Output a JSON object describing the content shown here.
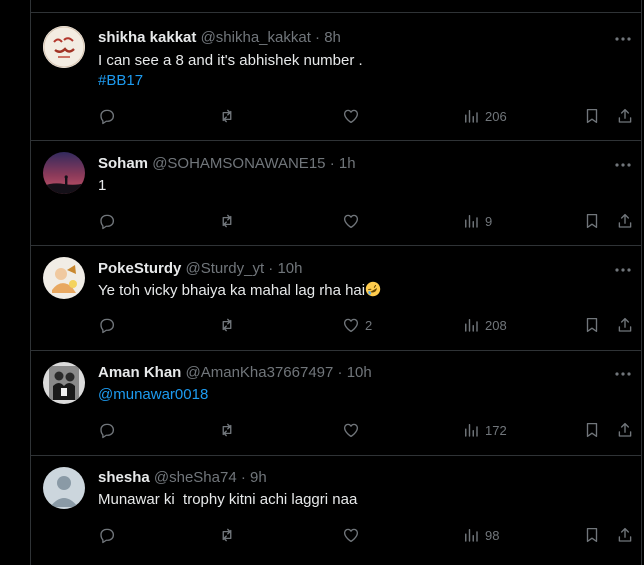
{
  "tweets": [
    {
      "name": "shikha kakkat",
      "handle": "@shikha_kakkat",
      "dot": "·",
      "time": "8h",
      "text": "I can see a 8 and it's abhishek number .",
      "hashtag": "#BB17",
      "likes": "",
      "views": "206"
    },
    {
      "name": "Soham",
      "handle": "@SOHAMSONAWANE15",
      "dot": "·",
      "time": "1h",
      "text": "1",
      "likes": "",
      "views": "9"
    },
    {
      "name": "PokeSturdy",
      "handle": "@Sturdy_yt",
      "dot": "·",
      "time": "10h",
      "text": "Ye toh vicky bhaiya ka mahal lag rha hai",
      "emoji": "rolling-on-floor-laughing-emoji",
      "likes": "2",
      "views": "208"
    },
    {
      "name": "Aman Khan",
      "handle": "@AmanKha37667497",
      "dot": "·",
      "time": "10h",
      "mention": "@munawar0018",
      "likes": "",
      "views": "172"
    },
    {
      "name": "shesha",
      "handle": "@sheSha74",
      "dot": "·",
      "time": "9h",
      "text": "Munawar ki  trophy kitni achi laggri naa",
      "likes": "",
      "views": "98"
    }
  ],
  "icons": {
    "reply": "reply-icon",
    "repost": "repost-icon",
    "like": "like-icon",
    "views": "views-icon",
    "bookmark": "bookmark-icon",
    "share": "share-icon",
    "more": "more-icon"
  },
  "colors": {
    "background": "#000000",
    "text": "#e7e9ea",
    "muted": "#71767b",
    "link": "#1d9bf0",
    "border": "#2f3336"
  }
}
